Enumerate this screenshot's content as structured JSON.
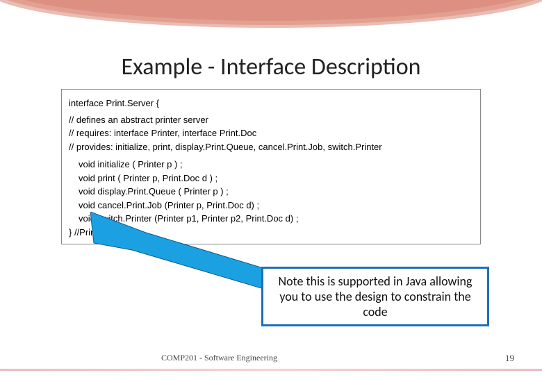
{
  "title": "Example - Interface Description",
  "code": {
    "line_interface": "interface Print.Server {",
    "comment1": "// defines an abstract printer server",
    "comment2": "// requires: interface Printer, interface Print.Doc",
    "comment3": "// provides: initialize, print, display.Print.Queue, cancel.Print.Job, switch.Printer",
    "m1": "void initialize ( Printer p ) ;",
    "m2": "void print ( Printer p, Print.Doc d ) ;",
    "m3": "void display.Print.Queue ( Printer p ) ;",
    "m4": "void cancel.Print.Job (Printer p, Print.Doc d) ;",
    "m5": "void switch.Printer (Printer p1, Printer p2, Print.Doc d) ;",
    "line_close": "} //Print.Server"
  },
  "callout_text": "Note this is supported in Java allowing you to use the design to constrain the code",
  "footer": {
    "course": "COMP201 - Software Engineering",
    "page": "19"
  },
  "colors": {
    "callout_border": "#1f6fb5",
    "arrow_fill": "#1ba1e2"
  }
}
